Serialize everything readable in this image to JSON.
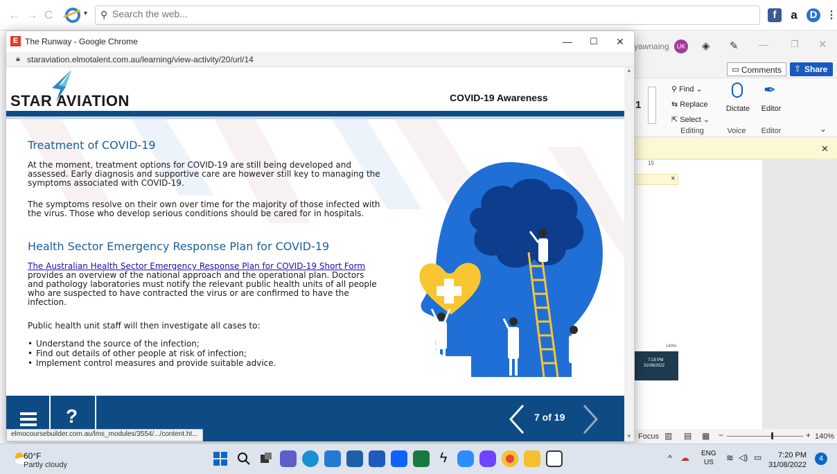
{
  "outer_browser": {
    "search_placeholder": "Search the web..."
  },
  "word": {
    "user_name": "yawnaing",
    "user_initials": "UK",
    "comments_label": "Comments",
    "share_label": "Share",
    "find_label": "Find",
    "replace_label": "Replace",
    "select_label": "Select",
    "dictate_label": "Dictate",
    "editor_label": "Editor",
    "group_editing": "Editing",
    "group_voice": "Voice",
    "group_editor": "Editor",
    "font_size_partial": "1",
    "ruler_number": "15",
    "focus_label": "Focus",
    "zoom_label": "140%",
    "mini_time": "7:19 PM",
    "mini_date": "31/08/2022",
    "mini_zoom": "140%"
  },
  "popup": {
    "window_title": "The Runway - Google Chrome",
    "url": "staraviation.elmotalent.com.au/learning/view-activity/20/url/14",
    "status_url": "elmocoursebuilder.com.au/lms_modules/3554/.../content.ht..."
  },
  "course": {
    "logo_text": "STAR AVIATION",
    "header_title": "COVID-19 Awareness",
    "heading1": "Treatment of COVID-19",
    "para1": "At the moment, treatment options for COVID-19 are still being developed and assessed. Early diagnosis and supportive care are however still key to managing the symptoms associated with COVID-19.",
    "para2": "The symptoms resolve on their own over time for the majority of those infected with the virus. Those who develop serious conditions should be cared for in hospitals.",
    "heading2": "Health Sector Emergency Response Plan for COVID-19",
    "link_text": "The Australian Health Sector Emergency Response Plan for COVID-19 Short Form",
    "para3_rest": "provides an overview of the national approach and the operational plan. Doctors and pathology laboratories must notify the relevant public health units of all people who are suspected to have contracted the virus or are confirmed to have the infection.",
    "para4": "Public health unit staff will then investigate all cases to:",
    "bullets": [
      "Understand the source of the infection;",
      "Find out details of other people at risk of infection;",
      "Implement control measures and provide suitable advice."
    ],
    "page_counter": "7 of 19"
  },
  "taskbar": {
    "weather_temp": "60°F",
    "weather_desc": "Partly cloudy",
    "lang": "ENG",
    "region": "US",
    "time": "7:20 PM",
    "date": "31/08/2022",
    "notification_count": "4"
  },
  "colors": {
    "brand_blue": "#0e4b84",
    "heading_blue": "#1b5e99",
    "illustration_blue": "#1f6fd6",
    "illustration_dark": "#0d3d8c",
    "heart_yellow": "#f7c631"
  }
}
